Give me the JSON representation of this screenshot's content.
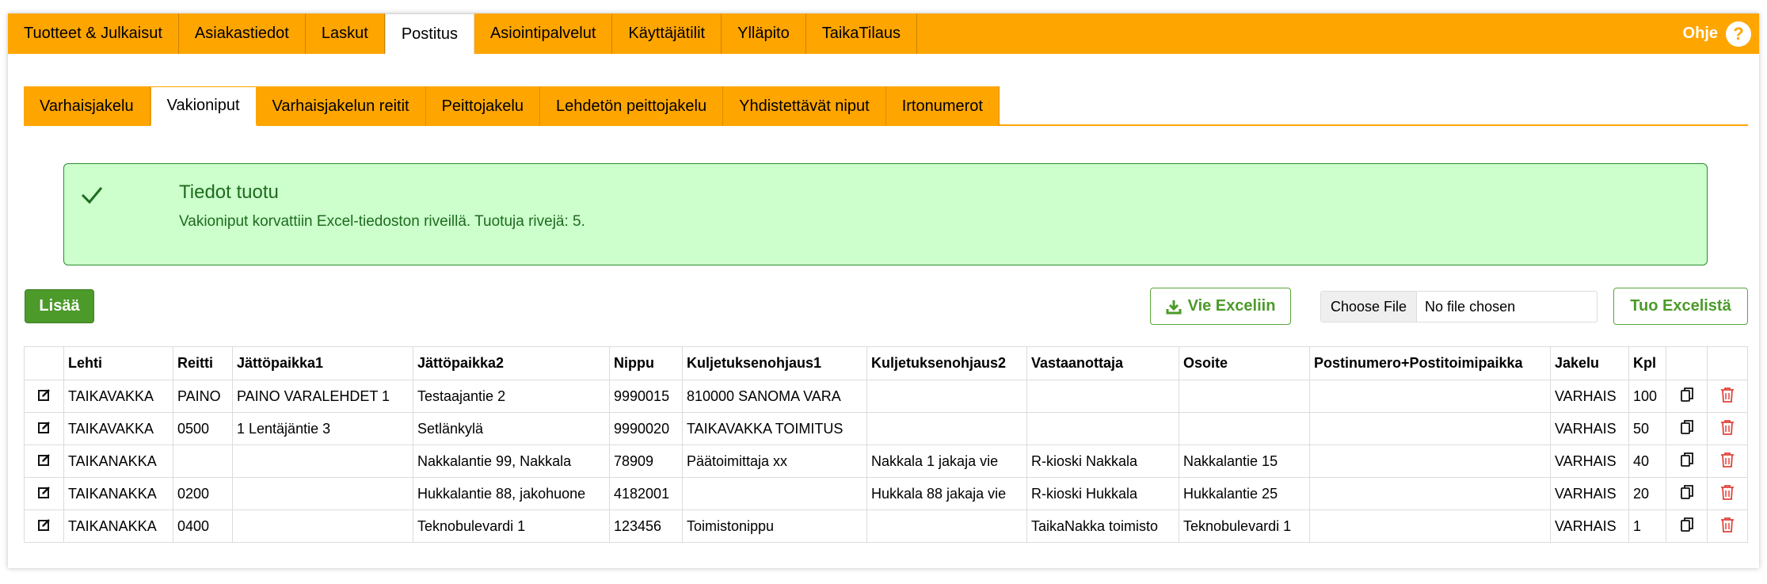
{
  "topnav": {
    "items": [
      {
        "label": "Tuotteet & Julkaisut"
      },
      {
        "label": "Asiakastiedot"
      },
      {
        "label": "Laskut"
      },
      {
        "label": "Postitus",
        "active": true
      },
      {
        "label": "Asiointipalvelut"
      },
      {
        "label": "Käyttäjätilit"
      },
      {
        "label": "Ylläpito"
      },
      {
        "label": "TaikaTilaus"
      }
    ],
    "help_label": "Ohje",
    "help_icon": "?"
  },
  "subtabs": [
    {
      "label": "Varhaisjakelu"
    },
    {
      "label": "Vakioniput",
      "active": true
    },
    {
      "label": "Varhaisjakelun reitit"
    },
    {
      "label": "Peittojakelu"
    },
    {
      "label": "Lehdetön peittojakelu"
    },
    {
      "label": "Yhdistettävät niput"
    },
    {
      "label": "Irtonumerot"
    }
  ],
  "alert": {
    "title": "Tiedot tuotu",
    "text": "Vakioniput korvattiin Excel-tiedoston riveillä. Tuotuja rivejä: 5."
  },
  "toolbar": {
    "add_label": "Lisää",
    "export_label": "Vie Exceliin",
    "file_button_label": "Choose File",
    "file_status": "No file chosen",
    "import_label": "Tuo Excelistä"
  },
  "table": {
    "columns": [
      "",
      "Lehti",
      "Reitti",
      "Jättöpaikka1",
      "Jättöpaikka2",
      "Nippu",
      "Kuljetuksenohjaus1",
      "Kuljetuksenohjaus2",
      "Vastaanottaja",
      "Osoite",
      "Postinumero+Postitoimipaikka",
      "Jakelu",
      "Kpl",
      "",
      ""
    ],
    "rows": [
      [
        "TAIKAVAKKA",
        "PAINO",
        "PAINO VARALEHDET 1",
        "Testaajantie 2",
        "9990015",
        "810000 SANOMA VARA",
        "",
        "",
        "",
        "",
        "VARHAIS",
        "100"
      ],
      [
        "TAIKAVAKKA",
        "0500",
        "1 Lentäjäntie 3",
        "Setlänkylä",
        "9990020",
        "TAIKAVAKKA TOIMITUS",
        "",
        "",
        "",
        "",
        "VARHAIS",
        "50"
      ],
      [
        "TAIKANAKKA",
        "",
        "",
        "Nakkalantie 99, Nakkala",
        "78909",
        "Päätoimittaja xx",
        "Nakkala 1 jakaja vie",
        "R-kioski Nakkala",
        "Nakkalantie 15",
        "",
        "VARHAIS",
        "40"
      ],
      [
        "TAIKANAKKA",
        "0200",
        "",
        "Hukkalantie 88, jakohuone",
        "4182001",
        "",
        "Hukkala 88 jakaja vie",
        "R-kioski Hukkala",
        "Hukkalantie 25",
        "",
        "VARHAIS",
        "20"
      ],
      [
        "TAIKANAKKA",
        "0400",
        "",
        "Teknobulevardi 1",
        "123456",
        "Toimistonippu",
        "",
        "TaikaNakka toimisto",
        "Teknobulevardi 1",
        "",
        "VARHAIS",
        "1"
      ]
    ]
  },
  "colors": {
    "accent": "#ffa500",
    "success_bg": "#ccffcc",
    "success_text": "#1e6b1e",
    "button_green": "#4c9a2a",
    "delete_red": "#e0443a"
  }
}
